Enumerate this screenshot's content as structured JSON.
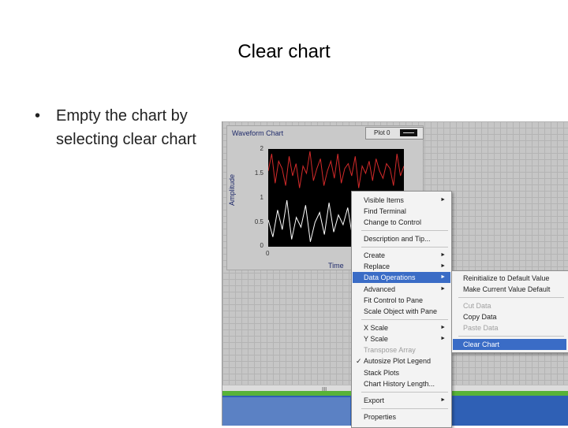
{
  "slide": {
    "title": "Clear chart",
    "bullet_symbol": "•",
    "bullet_text": "Empty the chart by selecting clear chart"
  },
  "waveform_chart": {
    "label": "Waveform Chart",
    "plot_legend": "Plot 0",
    "y_axis_label": "Amplitude",
    "x_axis_label": "Time",
    "y_ticks": [
      "2",
      "1.5",
      "1",
      "0.5",
      "0"
    ],
    "x_ticks": [
      "0"
    ],
    "colors": {
      "background": "#000000",
      "trace_red": "#d42a2a",
      "trace_white": "#ffffff"
    },
    "traces": {
      "red": [
        1.55,
        1.9,
        1.3,
        1.75,
        1.6,
        1.25,
        1.85,
        1.45,
        1.7,
        1.2,
        1.65,
        1.5,
        1.95,
        1.35,
        1.6,
        1.8,
        1.25,
        1.55,
        1.75,
        1.4,
        1.9,
        1.3,
        1.6,
        1.7,
        1.45,
        1.85,
        1.2,
        1.65,
        1.5,
        1.75,
        1.35,
        1.8,
        1.55,
        1.4,
        1.7,
        1.6,
        1.25,
        1.9,
        1.45,
        1.65
      ],
      "white": [
        0.55,
        0.2,
        0.75,
        0.35,
        0.95,
        0.15,
        0.6,
        0.4,
        0.85,
        0.1,
        0.5,
        0.7,
        0.25,
        0.9,
        0.3,
        0.65,
        0.45,
        0.8,
        0.2,
        0.55,
        0.35,
        0.75,
        0.15,
        0.6,
        0.5,
        0.9,
        0.25,
        0.7,
        0.4,
        0.85
      ]
    }
  },
  "context_menu": {
    "items": [
      {
        "label": "Visible Items",
        "submenu": true,
        "disabled": false
      },
      {
        "label": "Find Terminal",
        "submenu": false,
        "disabled": false
      },
      {
        "label": "Change to Control",
        "submenu": false,
        "disabled": false
      },
      {
        "label": "Description and Tip...",
        "submenu": false,
        "disabled": false
      },
      {
        "label": "Create",
        "submenu": true,
        "disabled": false
      },
      {
        "label": "Replace",
        "submenu": true,
        "disabled": false
      },
      {
        "label": "Data Operations",
        "submenu": true,
        "disabled": false,
        "highlighted": true
      },
      {
        "label": "Advanced",
        "submenu": true,
        "disabled": false
      },
      {
        "label": "Fit Control to Pane",
        "submenu": false,
        "disabled": false
      },
      {
        "label": "Scale Object with Pane",
        "submenu": false,
        "disabled": false
      },
      {
        "label": "X Scale",
        "submenu": true,
        "disabled": false
      },
      {
        "label": "Y Scale",
        "submenu": true,
        "disabled": false
      },
      {
        "label": "Transpose Array",
        "submenu": false,
        "disabled": true
      },
      {
        "label": "Autosize Plot Legend",
        "submenu": false,
        "disabled": false,
        "checked": true
      },
      {
        "label": "Stack Plots",
        "submenu": false,
        "disabled": false
      },
      {
        "label": "Chart History Length...",
        "submenu": false,
        "disabled": false
      },
      {
        "label": "Export",
        "submenu": true,
        "disabled": false
      },
      {
        "label": "Properties",
        "submenu": false,
        "disabled": false
      }
    ],
    "check_symbol": "✓",
    "arrow_symbol": "►"
  },
  "data_operations_submenu": {
    "items": [
      {
        "label": "Reinitialize to Default Value",
        "disabled": false
      },
      {
        "label": "Make Current Value Default",
        "disabled": false
      },
      {
        "label": "Cut Data",
        "disabled": true
      },
      {
        "label": "Copy Data",
        "disabled": false
      },
      {
        "label": "Paste Data",
        "disabled": true
      },
      {
        "label": "Clear Chart",
        "disabled": false,
        "highlighted": true
      }
    ]
  },
  "scrollbar": {
    "thumb_grip": "III"
  }
}
